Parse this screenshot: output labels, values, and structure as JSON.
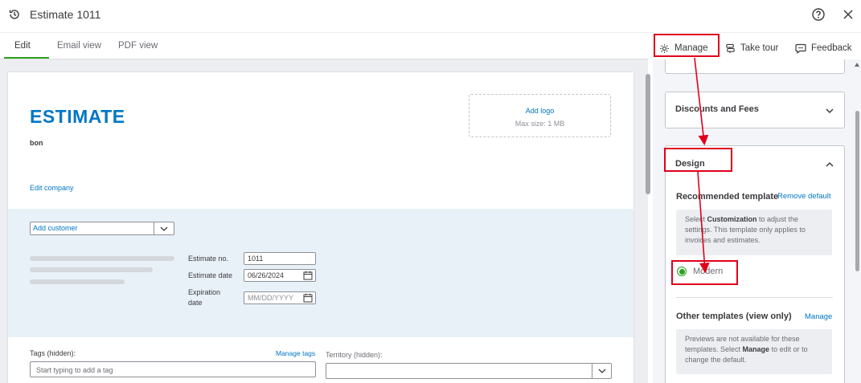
{
  "window": {
    "title": "Estimate 1011"
  },
  "tabs": [
    {
      "label": "Edit"
    },
    {
      "label": "Email view"
    },
    {
      "label": "PDF view"
    }
  ],
  "toolbar": {
    "manage_label": "Manage",
    "tour_label": "Take tour",
    "feedback_label": "Feedback"
  },
  "document": {
    "heading": "ESTIMATE",
    "company_name": "bon",
    "edit_company_label": "Edit company",
    "logo": {
      "add_label": "Add logo",
      "max_size": "Max size: 1 MB"
    },
    "customer": {
      "placeholder": "Add customer"
    },
    "fields": {
      "estimate_no_label": "Estimate no.",
      "estimate_no_value": "1011",
      "estimate_date_label": "Estimate date",
      "estimate_date_value": "06/26/2024",
      "expiration_label": "Expiration date",
      "expiration_placeholder": "MM/DD/YYYY"
    },
    "tags": {
      "label": "Tags (hidden):",
      "manage_label": "Manage tags",
      "placeholder": "Start typing to add a tag"
    },
    "territory": {
      "label": "Territory (hidden):"
    }
  },
  "side_panel": {
    "discounts_title": "Discounts and Fees",
    "design_title": "Design",
    "recommended_label": "Recommended template",
    "remove_default_label": "Remove default",
    "recommended_info_pre": "Select ",
    "recommended_info_bold": "Customization",
    "recommended_info_post": " to adjust the settings. This template only applies to invoices and estimates.",
    "template_option": "Modern",
    "other_label": "Other templates (view only)",
    "other_manage_label": "Manage",
    "other_info_pre": "Previews are not available for these templates. Select ",
    "other_info_bold": "Manage",
    "other_info_post": " to edit or to change the default."
  },
  "colors": {
    "accent_green": "#2ca01c",
    "link_blue": "#0077c5",
    "highlight_red": "#e0001b"
  }
}
